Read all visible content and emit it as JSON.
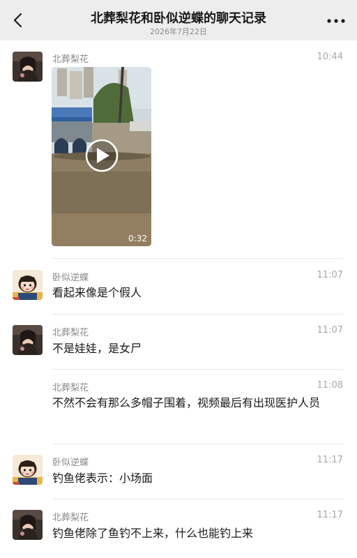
{
  "header": {
    "back_icon": "chevron-left-icon",
    "title": "北葬梨花和卧似逆蝶的聊天记录",
    "date": "2026年7月22日",
    "more_icon": "more-dots-icon"
  },
  "messages": [
    {
      "sender": "北葬梨花",
      "time": "10:44",
      "type": "video",
      "duration": "0:32",
      "avatar_icon": "avatar-woman-icon"
    },
    {
      "sender": "卧似逆蝶",
      "time": "11:07",
      "type": "text",
      "text": "看起来像是个假人",
      "avatar_icon": "avatar-cartoon-girl-icon"
    },
    {
      "sender": "北葬梨花",
      "time": "11:07",
      "type": "text",
      "text": "不是娃娃，是女尸",
      "avatar_icon": "avatar-woman-icon"
    },
    {
      "sender": "北葬梨花",
      "time": "11:08",
      "type": "text",
      "text": "不然不会有那么多帽子围着，视频最后有出现医护人员"
    },
    {
      "sender": "卧似逆蝶",
      "time": "11:17",
      "type": "text",
      "text": "钓鱼佬表示：小场面",
      "avatar_icon": "avatar-cartoon-girl-icon"
    },
    {
      "sender": "北葬梨花",
      "time": "11:17",
      "type": "text",
      "text": "钓鱼佬除了鱼钓不上来，什么也能钓上来",
      "avatar_icon": "avatar-woman-icon"
    }
  ],
  "colors": {
    "header_bg": "#ededed",
    "divider": "#e8e8e8",
    "secondary_text": "#8a8a8a"
  }
}
